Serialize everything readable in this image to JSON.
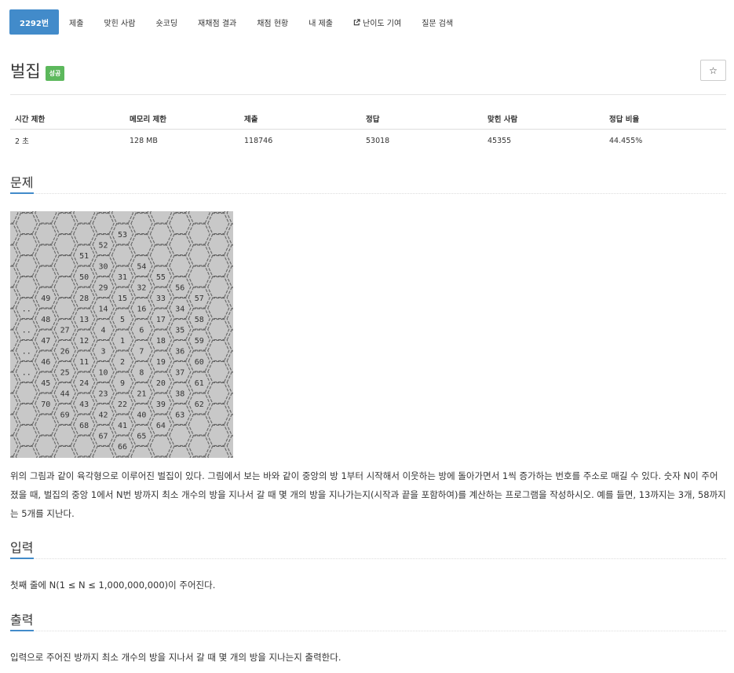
{
  "nav": {
    "items": [
      {
        "label": "2292번",
        "active": true
      },
      {
        "label": "제출"
      },
      {
        "label": "맞힌 사람"
      },
      {
        "label": "숏코딩"
      },
      {
        "label": "재채점 결과"
      },
      {
        "label": "채점 현황"
      },
      {
        "label": "내 제출"
      },
      {
        "label": "난이도 기여",
        "icon": "external-link-icon"
      },
      {
        "label": "질문 검색"
      }
    ]
  },
  "title": "벌집",
  "badge": "성공",
  "star_icon": "☆",
  "info_table": {
    "headers": [
      "시간 제한",
      "메모리 제한",
      "제출",
      "정답",
      "맞힌 사람",
      "정답 비율"
    ],
    "row": [
      "2 초",
      "128 MB",
      "118746",
      "53018",
      "45355",
      "44.455%"
    ]
  },
  "sections": {
    "problem": "문제",
    "input": "입력",
    "output": "출력"
  },
  "honeycomb_numbers": [
    {
      "n": "1",
      "q": 0,
      "r": 0
    },
    {
      "n": "2",
      "q": 0,
      "r": 1
    },
    {
      "n": "3",
      "q": -1,
      "r": 1
    },
    {
      "n": "4",
      "q": -1,
      "r": 0
    },
    {
      "n": "5",
      "q": 0,
      "r": -1
    },
    {
      "n": "6",
      "q": 1,
      "r": -1
    },
    {
      "n": "7",
      "q": 1,
      "r": 0
    },
    {
      "n": "8",
      "q": 1,
      "r": 1
    },
    {
      "n": "9",
      "q": 0,
      "r": 2
    },
    {
      "n": "10",
      "q": -1,
      "r": 2
    },
    {
      "n": "11",
      "q": -2,
      "r": 2
    },
    {
      "n": "12",
      "q": -2,
      "r": 1
    },
    {
      "n": "13",
      "q": -2,
      "r": 0
    },
    {
      "n": "14",
      "q": -1,
      "r": -1
    },
    {
      "n": "15",
      "q": 0,
      "r": -2
    },
    {
      "n": "16",
      "q": 1,
      "r": -2
    },
    {
      "n": "17",
      "q": 2,
      "r": -2
    },
    {
      "n": "18",
      "q": 2,
      "r": -1
    },
    {
      "n": "19",
      "q": 2,
      "r": 0
    },
    {
      "n": "20",
      "q": 2,
      "r": 1
    },
    {
      "n": "21",
      "q": 1,
      "r": 2
    },
    {
      "n": "22",
      "q": 0,
      "r": 3
    },
    {
      "n": "23",
      "q": -1,
      "r": 3
    },
    {
      "n": "24",
      "q": -2,
      "r": 3
    },
    {
      "n": "25",
      "q": -3,
      "r": 3
    },
    {
      "n": "26",
      "q": -3,
      "r": 2
    },
    {
      "n": "27",
      "q": -3,
      "r": 1
    },
    {
      "n": "28",
      "q": -2,
      "r": -1
    },
    {
      "n": "29",
      "q": -1,
      "r": -2
    },
    {
      "n": "30",
      "q": -1,
      "r": -3
    },
    {
      "n": "31",
      "q": 0,
      "r": -3
    },
    {
      "n": "32",
      "q": 1,
      "r": -3
    },
    {
      "n": "33",
      "q": 2,
      "r": -3
    },
    {
      "n": "34",
      "q": 3,
      "r": -3
    },
    {
      "n": "35",
      "q": 3,
      "r": -2
    },
    {
      "n": "36",
      "q": 3,
      "r": -1
    },
    {
      "n": "37",
      "q": 3,
      "r": 0
    },
    {
      "n": "38",
      "q": 3,
      "r": 1
    },
    {
      "n": "39",
      "q": 2,
      "r": 2
    },
    {
      "n": "40",
      "q": 1,
      "r": 3
    },
    {
      "n": "41",
      "q": 0,
      "r": 4
    },
    {
      "n": "42",
      "q": -1,
      "r": 4
    },
    {
      "n": "43",
      "q": -2,
      "r": 4
    },
    {
      "n": "44",
      "q": -3,
      "r": 4
    },
    {
      "n": "45",
      "q": -4,
      "r": 4
    },
    {
      "n": "46",
      "q": -4,
      "r": 3
    },
    {
      "n": "47",
      "q": -4,
      "r": 2
    },
    {
      "n": "48",
      "q": -4,
      "r": 1
    },
    {
      "n": "49",
      "q": -4,
      "r": 0
    },
    {
      "n": "50",
      "q": -2,
      "r": -2
    },
    {
      "n": "51",
      "q": -2,
      "r": -3
    },
    {
      "n": "52",
      "q": -1,
      "r": -4
    },
    {
      "n": "53",
      "q": 0,
      "r": -5
    },
    {
      "n": "54",
      "q": 1,
      "r": -4
    },
    {
      "n": "55",
      "q": 2,
      "r": -4
    },
    {
      "n": "56",
      "q": 3,
      "r": -4
    },
    {
      "n": "57",
      "q": 4,
      "r": -4
    },
    {
      "n": "58",
      "q": 4,
      "r": -3
    },
    {
      "n": "59",
      "q": 4,
      "r": -2
    },
    {
      "n": "60",
      "q": 4,
      "r": -1
    },
    {
      "n": "61",
      "q": 4,
      "r": 0
    },
    {
      "n": "62",
      "q": 4,
      "r": 1
    },
    {
      "n": "63",
      "q": 3,
      "r": 2
    },
    {
      "n": "64",
      "q": 2,
      "r": 3
    },
    {
      "n": "65",
      "q": 1,
      "r": 4
    },
    {
      "n": "66",
      "q": 0,
      "r": 5
    },
    {
      "n": "67",
      "q": -1,
      "r": 5
    },
    {
      "n": "68",
      "q": -2,
      "r": 5
    },
    {
      "n": "69",
      "q": -3,
      "r": 5
    },
    {
      "n": "70",
      "q": -4,
      "r": 5
    },
    {
      "n": "..",
      "q": -5,
      "r": 1
    },
    {
      "n": "..",
      "q": -5,
      "r": 2
    },
    {
      "n": "..",
      "q": -5,
      "r": 3
    },
    {
      "n": "..",
      "q": -5,
      "r": 4
    }
  ],
  "problem_text": "위의 그림과 같이 육각형으로 이루어진 벌집이 있다. 그림에서 보는 바와 같이 중앙의 방 1부터 시작해서 이웃하는 방에 돌아가면서 1씩 증가하는 번호를 주소로 매길 수 있다. 숫자 N이 주어졌을 때, 벌집의 중앙 1에서 N번 방까지 최소 개수의 방을 지나서 갈 때 몇 개의 방을 지나가는지(시작과 끝을 포함하여)를 계산하는 프로그램을 작성하시오. 예를 들면, 13까지는 3개, 58까지는 5개를 지난다.",
  "input_text": "첫째 줄에 N(1 ≤ N ≤ 1,000,000,000)이 주어진다.",
  "output_text": "입력으로 주어진 방까지 최소 개수의 방을 지나서 갈 때 몇 개의 방을 지나는지 출력한다."
}
